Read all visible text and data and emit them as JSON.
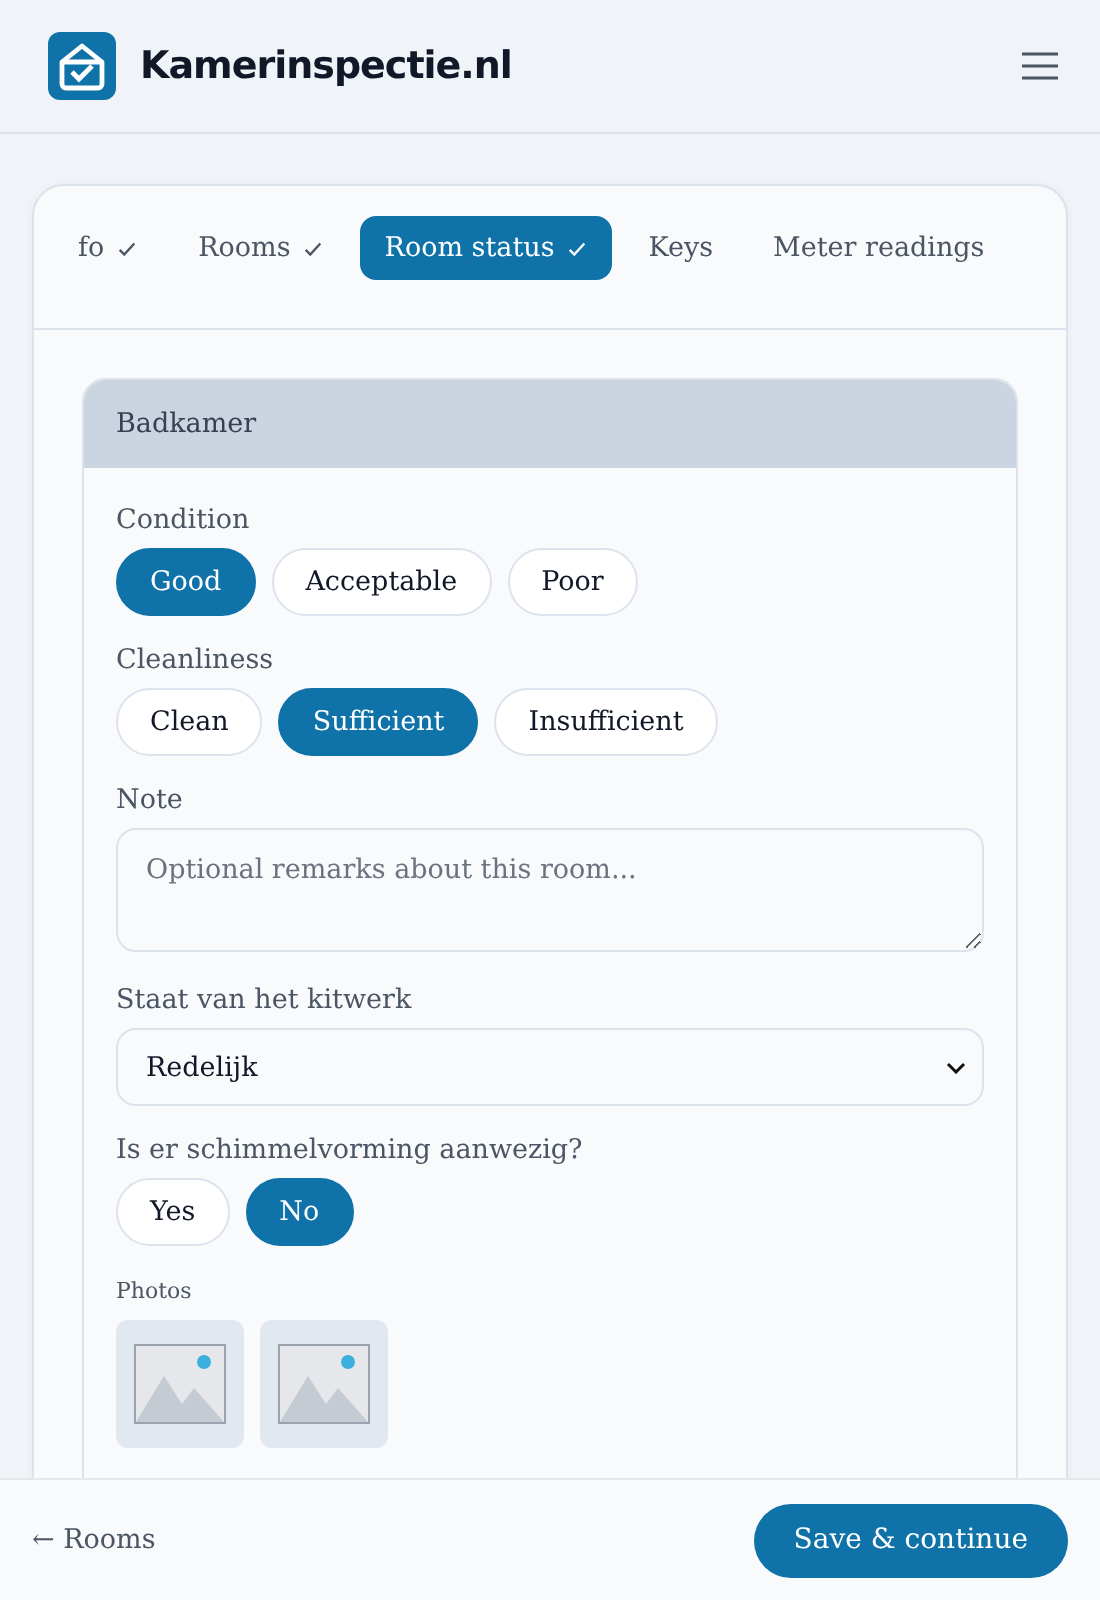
{
  "header": {
    "brand": "Kamerinspectie.nl"
  },
  "tabs": [
    {
      "label": "fo",
      "done": true,
      "selected": false
    },
    {
      "label": "Rooms",
      "done": true,
      "selected": false
    },
    {
      "label": "Room status",
      "done": true,
      "selected": true
    },
    {
      "label": "Keys",
      "done": false,
      "selected": false
    },
    {
      "label": "Meter readings",
      "done": false,
      "selected": false
    }
  ],
  "room": {
    "title": "Badkamer",
    "groups": [
      {
        "label": "Condition",
        "options": [
          {
            "label": "Good",
            "selected": true
          },
          {
            "label": "Acceptable",
            "selected": false
          },
          {
            "label": "Poor",
            "selected": false
          }
        ]
      },
      {
        "label": "Cleanliness",
        "options": [
          {
            "label": "Clean",
            "selected": false
          },
          {
            "label": "Sufficient",
            "selected": true
          },
          {
            "label": "Insufficient",
            "selected": false
          }
        ]
      }
    ],
    "note": {
      "label": "Note",
      "placeholder": "Optional remarks about this room..."
    },
    "select": {
      "label": "Staat van het kitwerk",
      "value": "Redelijk"
    },
    "question": {
      "label": "Is er schimmelvorming aanwezig?",
      "options": [
        {
          "label": "Yes",
          "selected": false
        },
        {
          "label": "No",
          "selected": true
        }
      ]
    },
    "photos": {
      "label": "Photos",
      "items": [
        {
          "kind": "placeholder"
        },
        {
          "kind": "placeholder"
        }
      ]
    }
  },
  "footer": {
    "back": "← Rooms",
    "next": "Save & continue"
  }
}
